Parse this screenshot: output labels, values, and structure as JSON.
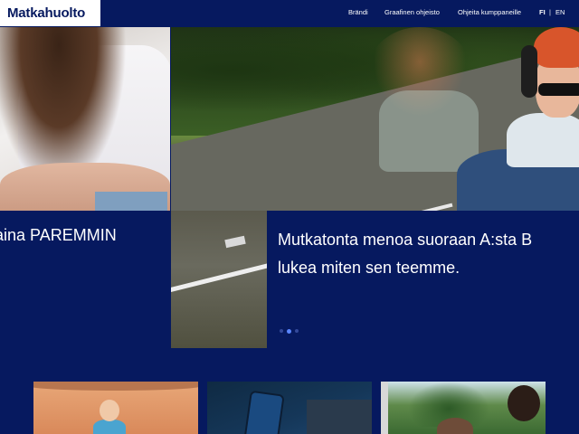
{
  "header": {
    "logo_text": "Matkahuolto",
    "nav": [
      {
        "label": "Brändi"
      },
      {
        "label": "Graafinen ohjeisto"
      },
      {
        "label": "Ohjeita kumppaneille"
      }
    ],
    "lang": {
      "fi": "FI",
      "separator": "|",
      "en": "EN"
    }
  },
  "hero": {
    "left_caption": "aina PAREMMIN",
    "main_caption_line1": "Mutkatonta menoa suoraan A:sta B",
    "main_caption_line2": "lukea miten sen teemme.",
    "slides_count": 3,
    "active_slide": 2
  },
  "colors": {
    "background": "#06195f",
    "logo_bg": "#ffffff",
    "dot_active": "#5a86ff",
    "dot_inactive": "#33499a"
  },
  "cards": [
    {
      "icon": "baby-photo"
    },
    {
      "icon": "phone-photo"
    },
    {
      "icon": "family-train-photo"
    }
  ]
}
